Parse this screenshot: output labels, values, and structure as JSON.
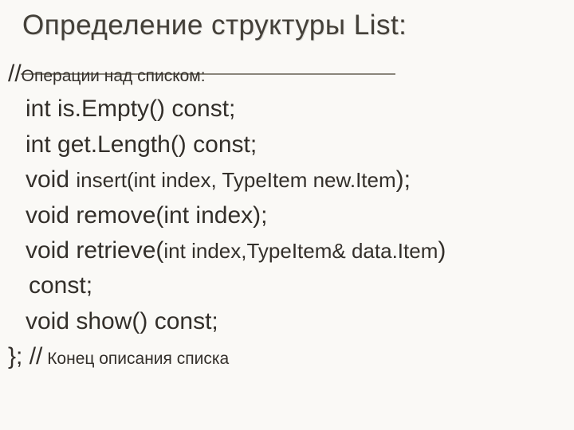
{
  "title": "Определение структуры List:",
  "lines": {
    "comment1_a": "//",
    "comment1_b": "Операции над списком:",
    "l1": "int is.Empty() const;",
    "l2": "int get.Length() const;",
    "l3_a": "void ",
    "l3_b": "insert(int index, TypeItem new.Item",
    "l3_c": ");",
    "l4": "void remove(int index);",
    "l5_a": "void retrieve(",
    "l5_b": "int index,TypeItem& data.Item",
    "l5_c": ")",
    "l6": "const;",
    "l7": "void show() const;",
    "l8_a": "}; //",
    "l8_b": " Конец описания списка"
  }
}
